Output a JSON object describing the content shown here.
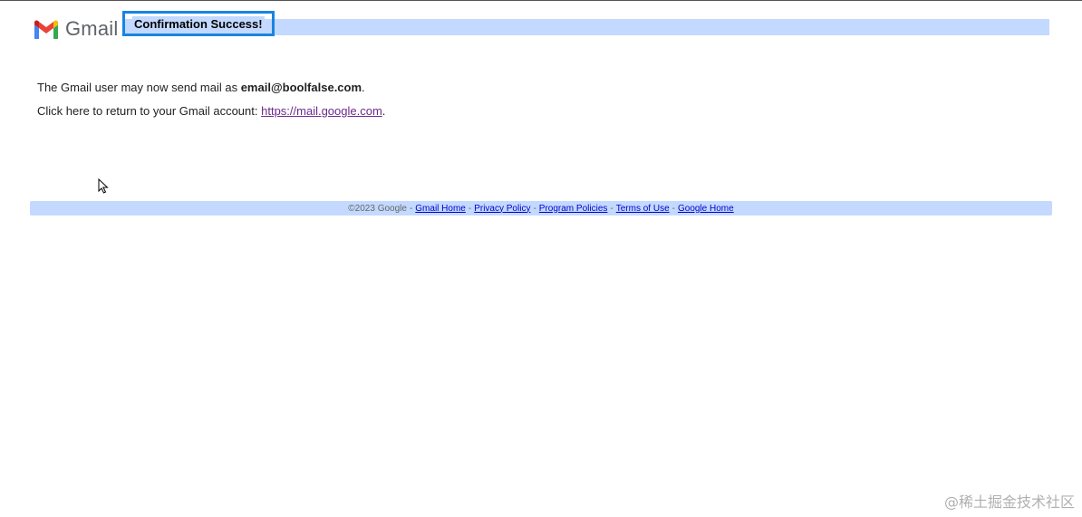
{
  "header": {
    "logo_text": "Gmail",
    "title": "Confirmation Success!"
  },
  "content": {
    "line1_prefix": "The Gmail user may now send mail as ",
    "line1_email": "email@boolfalse.com",
    "line1_suffix": ".",
    "line2_prefix": "Click here to return to your Gmail account: ",
    "line2_link": "https://mail.google.com",
    "line2_suffix": "."
  },
  "footer": {
    "copyright": "©2023 Google",
    "separator": "-",
    "links": [
      "Gmail Home",
      "Privacy Policy",
      "Program Policies",
      "Terms of Use",
      "Google Home"
    ]
  },
  "watermark": "@稀土掘金技术社区",
  "colors": {
    "bar": "#c3d9ff",
    "highlight_border": "#1a84e0",
    "visited_link": "#6a2a8c",
    "footer_link": "#0000cc"
  }
}
